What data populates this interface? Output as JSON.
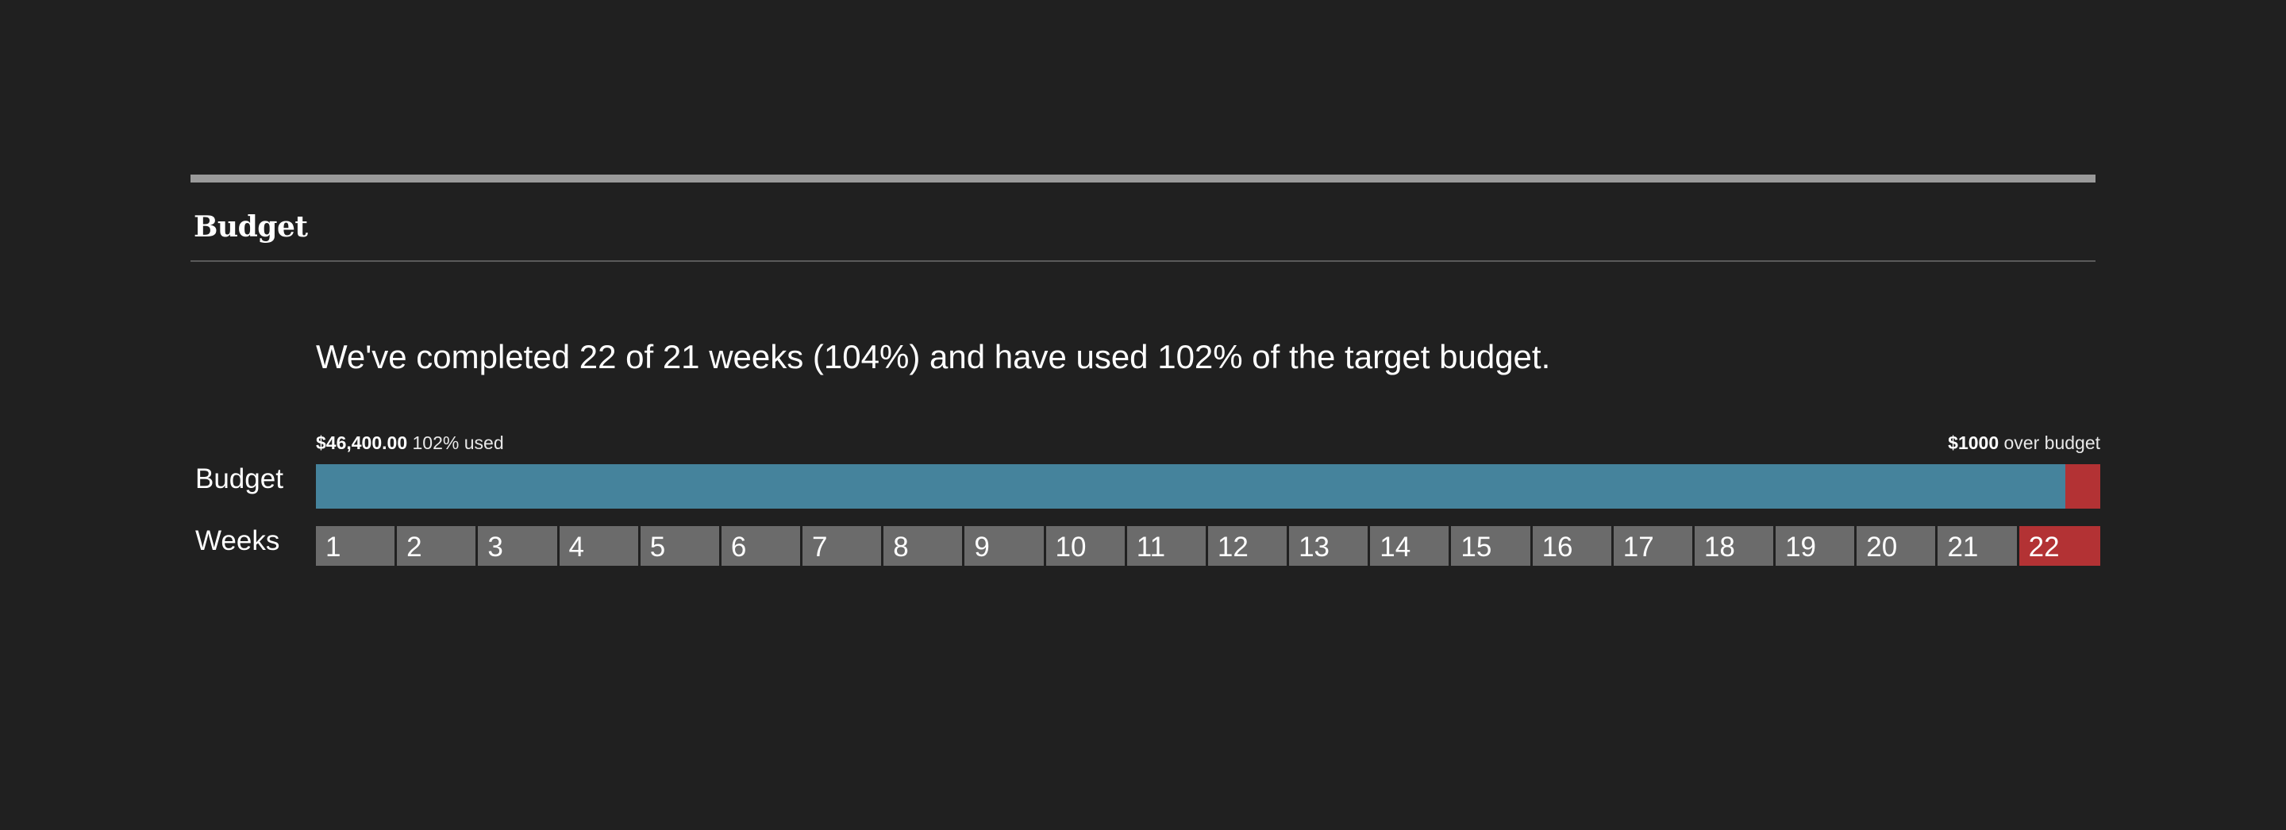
{
  "section": {
    "title": "Budget"
  },
  "summary": "We've completed 22 of 21 weeks (104%) and have used 102% of the target budget.",
  "budget": {
    "amount_label": "$46,400.00",
    "used_label": "102% used",
    "over_amount_label": "$1000",
    "over_suffix": "over budget",
    "used_fraction": 0.9804,
    "over_fraction": 0.0196,
    "used_color": "#45839c",
    "over_color": "#b33234"
  },
  "labels": {
    "budget_row": "Budget",
    "weeks_row": "Weeks"
  },
  "weeks": {
    "target": 21,
    "completed": 22,
    "items": [
      "1",
      "2",
      "3",
      "4",
      "5",
      "6",
      "7",
      "8",
      "9",
      "10",
      "11",
      "12",
      "13",
      "14",
      "15",
      "16",
      "17",
      "18",
      "19",
      "20",
      "21",
      "22"
    ],
    "normal_color": "#6b6b6b",
    "over_color": "#b33234"
  }
}
